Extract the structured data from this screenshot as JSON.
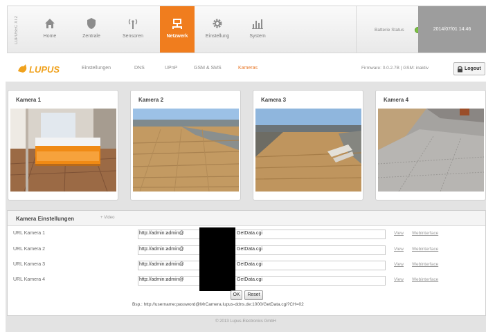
{
  "brand_vertical": "LUPUSEC XT2",
  "nav": {
    "items": [
      {
        "label": "Home",
        "icon": "home-icon"
      },
      {
        "label": "Zentrale",
        "icon": "shield-icon"
      },
      {
        "label": "Sensoren",
        "icon": "sensor-icon"
      },
      {
        "label": "Netzwerk",
        "icon": "network-icon",
        "active": true
      },
      {
        "label": "Einstellung",
        "icon": "gear-icon"
      },
      {
        "label": "System",
        "icon": "system-chart-icon"
      }
    ],
    "status_label": "Batterie Status",
    "datetime": "2014/07/01 14:46"
  },
  "subnav": {
    "logo": "LUPUS",
    "items": [
      {
        "label": "Einstellungen"
      },
      {
        "label": "DNS"
      },
      {
        "label": "UPnP"
      },
      {
        "label": "GSM & SMS"
      },
      {
        "label": "Kameras",
        "active": true
      }
    ],
    "firmware": "Firmware: 0.0.2.7B | GSM: inaktiv",
    "logout": "Logout"
  },
  "cameras": [
    {
      "title": "Kamera 1"
    },
    {
      "title": "Kamera 2"
    },
    {
      "title": "Kamera 3"
    },
    {
      "title": "Kamera 4"
    }
  ],
  "settings": {
    "title": "Kamera Einstellungen",
    "video_label": "Video",
    "rows": [
      {
        "label": "URL Kamera 1",
        "url_left": "http://admin:admin@",
        "url_right": "GetData.cgi",
        "view": "View",
        "web": "Webinterface"
      },
      {
        "label": "URL Kamera 2",
        "url_left": "http://admin:admin@",
        "url_right": "GetData.cgi",
        "view": "View",
        "web": "Webinterface"
      },
      {
        "label": "URL Kamera 3",
        "url_left": "http://admin:admin@",
        "url_right": "GetData.cgi",
        "view": "View",
        "web": "Webinterface"
      },
      {
        "label": "URL Kamera 4",
        "url_left": "http://admin:admin@",
        "url_right": "GetData.cgi",
        "view": "View",
        "web": "Webinterface"
      }
    ],
    "ok": "OK",
    "reset": "Reset",
    "example": "Bsp.: http://username:password@MrCamera.lupus-ddns.de:1000/GetData.cgi?CH=02"
  },
  "footer": "© 2013 Lupus-Electronics GmbH",
  "colors": {
    "accent": "#f07d1e",
    "status_ok": "#7cc142",
    "datetime_bg": "#9d9d9d"
  }
}
